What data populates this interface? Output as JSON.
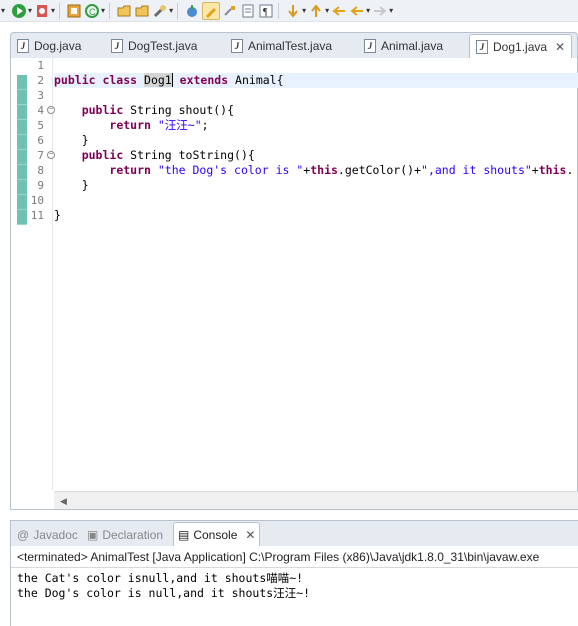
{
  "toolbar": {
    "icons": [
      "debug-icon",
      "run-icon",
      "external-tools-icon",
      "new-project-icon",
      "refresh-icon",
      "open-type-icon",
      "open-folder-icon",
      "search-icon",
      "breakpoint-icon",
      "highlight-icon",
      "toggle-block-icon",
      "show-whitespace-icon",
      "paragraph-icon",
      "next-annotation-icon",
      "prev-annotation-icon",
      "back-icon",
      "forward-icon"
    ]
  },
  "editor_tabs": [
    {
      "label": "Dog.java",
      "active": false
    },
    {
      "label": "DogTest.java",
      "active": false
    },
    {
      "label": "AnimalTest.java",
      "active": false
    },
    {
      "label": "Animal.java",
      "active": false
    },
    {
      "label": "Dog1.java",
      "active": true,
      "close": "✕"
    }
  ],
  "code": {
    "lines": [
      {
        "n": "1",
        "segs": []
      },
      {
        "n": "2",
        "segs": [
          {
            "t": "public class ",
            "c": "kw"
          },
          {
            "t": "Dog1",
            "c": "hl"
          },
          {
            "t": " ",
            "c": ""
          },
          {
            "t": "extends",
            "c": "kw"
          },
          {
            "t": " Animal{",
            "c": ""
          }
        ]
      },
      {
        "n": "3",
        "segs": []
      },
      {
        "n": "4",
        "segs": [
          {
            "t": "    ",
            "c": ""
          },
          {
            "t": "public",
            "c": "kw"
          },
          {
            "t": " String shout(){",
            "c": ""
          }
        ]
      },
      {
        "n": "5",
        "segs": [
          {
            "t": "        ",
            "c": ""
          },
          {
            "t": "return",
            "c": "kw"
          },
          {
            "t": " ",
            "c": ""
          },
          {
            "t": "\"汪汪~\"",
            "c": "str"
          },
          {
            "t": ";",
            "c": ""
          }
        ]
      },
      {
        "n": "6",
        "segs": [
          {
            "t": "    }",
            "c": ""
          }
        ]
      },
      {
        "n": "7",
        "segs": [
          {
            "t": "    ",
            "c": ""
          },
          {
            "t": "public",
            "c": "kw"
          },
          {
            "t": " String toString(){",
            "c": ""
          }
        ]
      },
      {
        "n": "8",
        "segs": [
          {
            "t": "        ",
            "c": ""
          },
          {
            "t": "return",
            "c": "kw"
          },
          {
            "t": " ",
            "c": ""
          },
          {
            "t": "\"the Dog's color is \"",
            "c": "str"
          },
          {
            "t": "+",
            "c": ""
          },
          {
            "t": "this",
            "c": "kw"
          },
          {
            "t": ".getColor()+",
            "c": ""
          },
          {
            "t": "\",and it shouts\"",
            "c": "str"
          },
          {
            "t": "+",
            "c": ""
          },
          {
            "t": "this",
            "c": "kw"
          },
          {
            "t": ".",
            "c": ""
          }
        ]
      },
      {
        "n": "9",
        "segs": [
          {
            "t": "    }",
            "c": ""
          }
        ]
      },
      {
        "n": "10",
        "segs": []
      },
      {
        "n": "11",
        "segs": [
          {
            "t": "}",
            "c": ""
          }
        ]
      }
    ]
  },
  "panel": {
    "tabs": [
      {
        "label": "Javadoc",
        "icon": "@"
      },
      {
        "label": "Declaration",
        "icon": "▣"
      },
      {
        "label": "Console",
        "icon": "▤",
        "close": "✕"
      }
    ],
    "status": "<terminated> AnimalTest [Java Application] C:\\Program Files (x86)\\Java\\jdk1.8.0_31\\bin\\javaw.exe",
    "output": [
      "the Cat's color isnull,and it shouts喵喵~!",
      "the Dog's color is null,and it shouts汪汪~!"
    ]
  },
  "colors": {
    "keyword": "#7f0055",
    "string": "#2a00ff",
    "current_line": "#e8f2fe",
    "ruler_mark": "#6fc2b2"
  }
}
